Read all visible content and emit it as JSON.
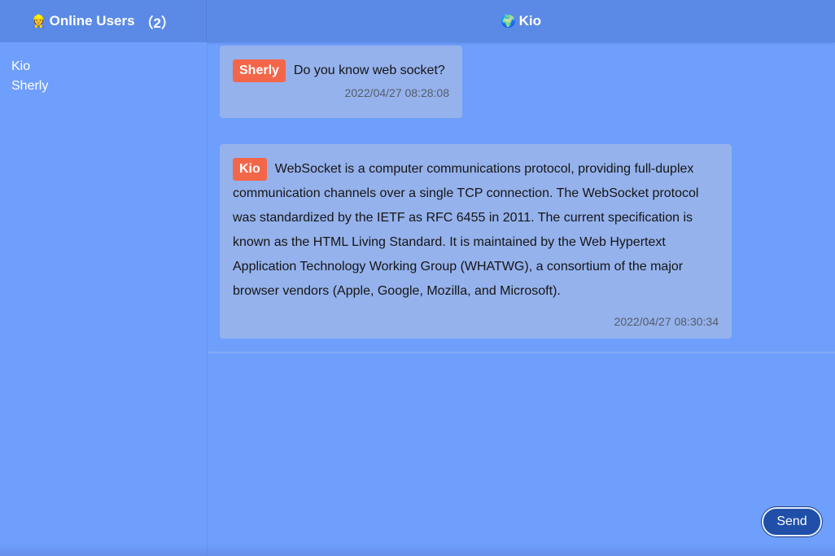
{
  "header": {
    "online_icon": "👷",
    "online_title": "Online Users",
    "online_count": "（2）",
    "globe_icon": "🌍",
    "current_user": "Kio"
  },
  "sidebar": {
    "users": [
      {
        "name": "Kio"
      },
      {
        "name": "Sherly"
      }
    ]
  },
  "messages": [
    {
      "sender": "Sherly",
      "text": "Do you know web socket?",
      "time": "2022/04/27 08:28:08"
    },
    {
      "sender": "Kio",
      "text": "WebSocket is a computer communications protocol, providing full-duplex communication channels over a single TCP connection. The WebSocket protocol was standardized by the IETF as RFC 6455 in 2011. The current specification is known as the HTML Living Standard. It is maintained by the Web Hypertext Application Technology Working Group (WHATWG), a consortium of the major browser vendors (Apple, Google, Mozilla, and Microsoft).",
      "time": "2022/04/27 08:30:34"
    }
  ],
  "composer": {
    "send_label": "Send"
  },
  "colors": {
    "background": "#6f9ffc",
    "header": "#5b8ae6",
    "bubble": "#95b2ec",
    "badge": "#f4664a",
    "send_button": "#1f4fa8"
  }
}
